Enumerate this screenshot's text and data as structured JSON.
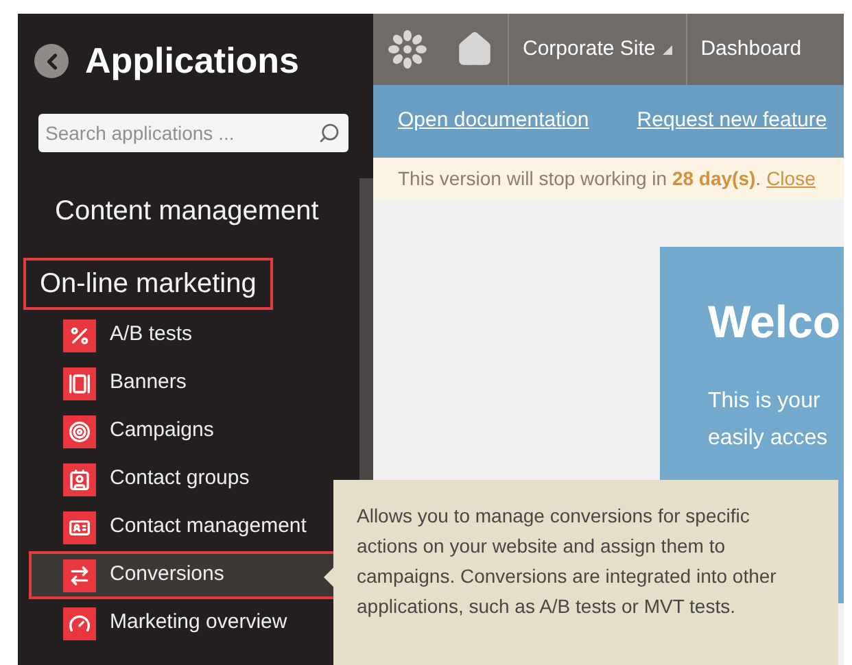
{
  "sidebar": {
    "title": "Applications",
    "search": {
      "placeholder": "Search applications ..."
    },
    "sections": [
      {
        "label": "Content management",
        "highlighted": false
      },
      {
        "label": "On-line marketing",
        "highlighted": true
      }
    ],
    "items": [
      {
        "label": "A/B tests",
        "selected": false,
        "highlighted": false
      },
      {
        "label": "Banners",
        "selected": false,
        "highlighted": false
      },
      {
        "label": "Campaigns",
        "selected": false,
        "highlighted": false
      },
      {
        "label": "Contact groups",
        "selected": false,
        "highlighted": false
      },
      {
        "label": "Contact management",
        "selected": false,
        "highlighted": false
      },
      {
        "label": "Conversions",
        "selected": true,
        "highlighted": true
      },
      {
        "label": "Marketing overview",
        "selected": false,
        "highlighted": false
      }
    ]
  },
  "top_bar": {
    "site": "Corporate Site",
    "tab": "Dashboard"
  },
  "links": [
    "Open documentation",
    "Request new feature"
  ],
  "notice": {
    "text": "This version will stop working in **28 day(s)**.",
    "link": "Close"
  },
  "welcome": {
    "title": "Welco",
    "lines": [
      "This is your",
      "easily acces"
    ]
  },
  "tooltip": {
    "text": "Allows you to manage conversions for specific actions on your website and assign them to campaigns. Conversions are integrated into other applications, such as A/B tests or MVT tests."
  }
}
